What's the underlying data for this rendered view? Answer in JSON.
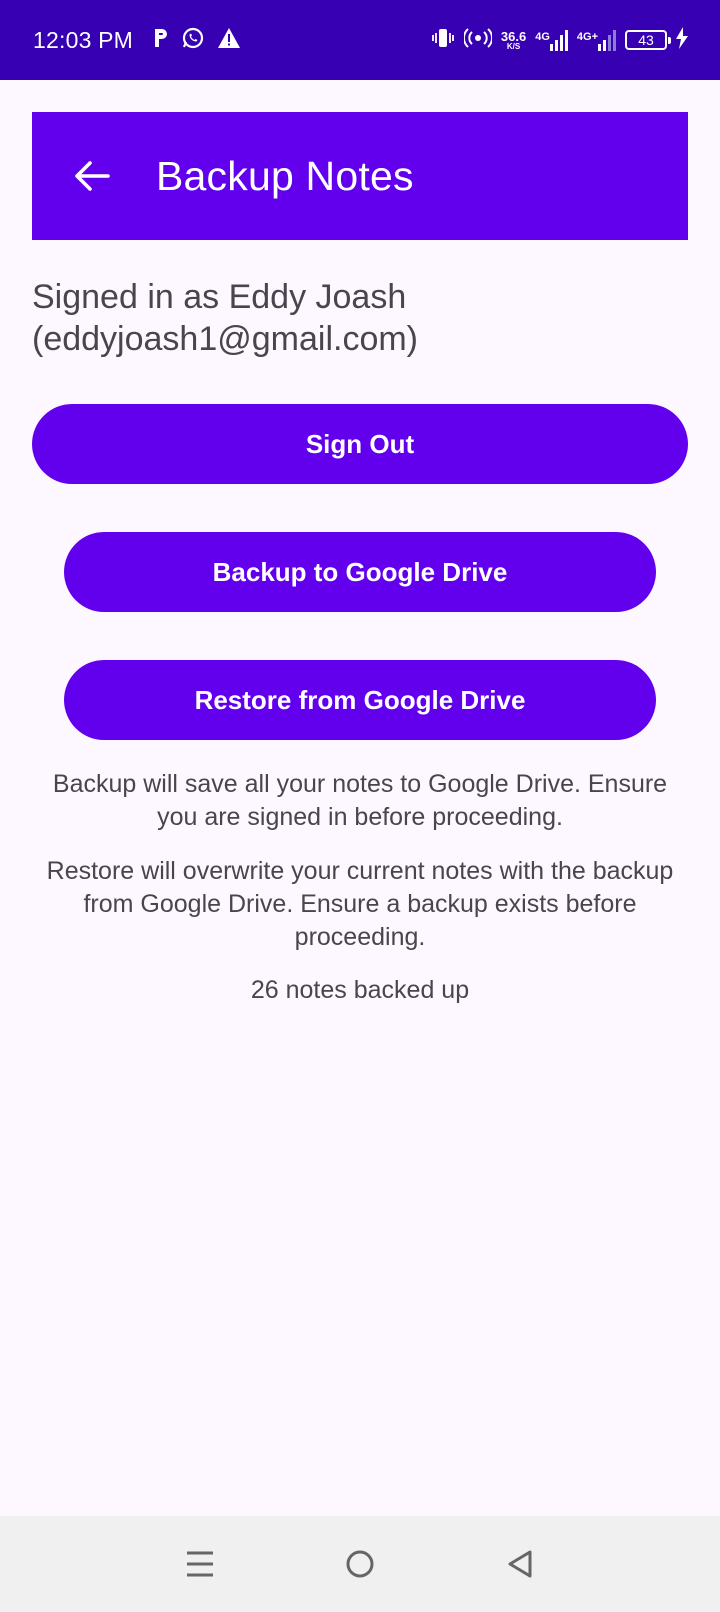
{
  "status_bar": {
    "time": "12:03 PM",
    "left_icons": [
      "parking-icon",
      "whatsapp-icon",
      "warning-icon"
    ],
    "net_speed_value": "36.6",
    "net_speed_unit": "K/S",
    "sim1_label": "4G",
    "sim2_label": "4G+",
    "battery_level": "43"
  },
  "toolbar": {
    "title": "Backup Notes",
    "back_icon": "arrow-left-icon"
  },
  "account": {
    "signed_in_text": "Signed in as Eddy Joash (eddyjoash1@gmail.com)"
  },
  "buttons": {
    "sign_out": "Sign Out",
    "backup": "Backup to Google Drive",
    "restore": "Restore from Google Drive"
  },
  "info": {
    "backup_note": "Backup will save all your notes to Google Drive. Ensure you are signed in before proceeding.",
    "restore_note": "Restore will overwrite your current notes with the backup from Google Drive. Ensure a backup exists before proceeding.",
    "backup_count": "26 notes backed up"
  },
  "colors": {
    "status_bar": "#3700b3",
    "primary": "#6200ee",
    "background": "#fdf8ff",
    "text": "#49454f"
  },
  "nav_bar": {
    "icons": [
      "menu-icon",
      "home-circle-icon",
      "back-triangle-icon"
    ]
  }
}
